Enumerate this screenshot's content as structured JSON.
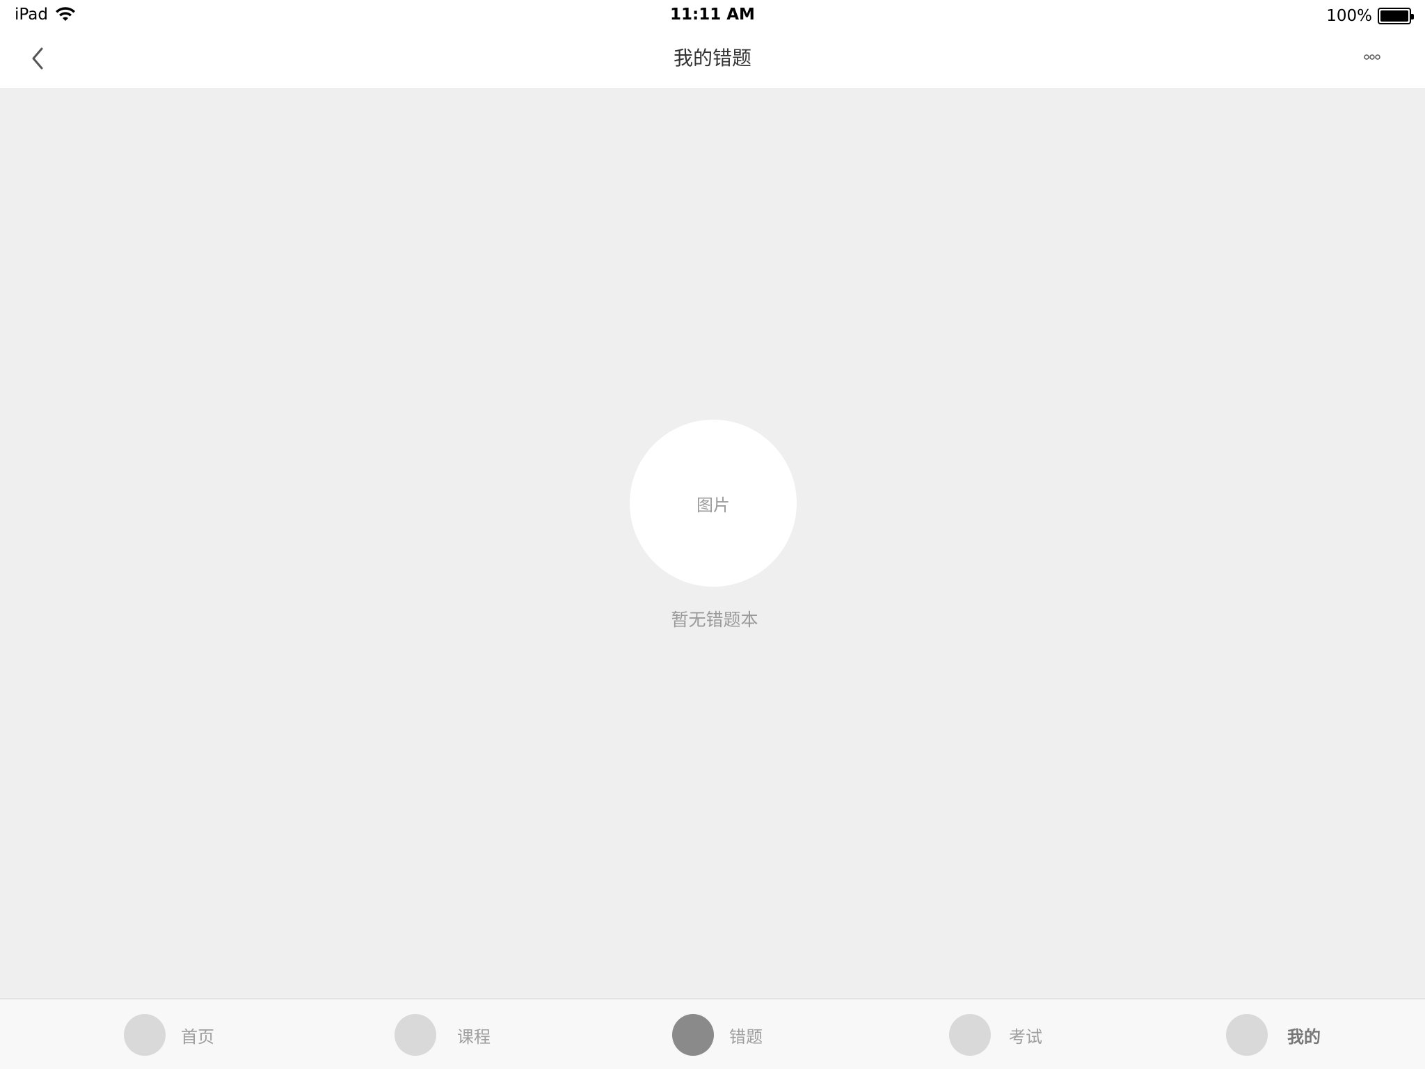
{
  "status_bar": {
    "device": "iPad",
    "time": "11:11 AM",
    "battery": "100%",
    "battery_level": 1.0
  },
  "nav": {
    "title": "我的错题",
    "back_icon": "chevron-left-icon",
    "more_icon": "more-dots-icon"
  },
  "empty_state": {
    "image_placeholder": "图片",
    "message": "暂无错题本"
  },
  "tabs": [
    {
      "label": "首页",
      "active": false
    },
    {
      "label": "课程",
      "active": false
    },
    {
      "label": "错题",
      "active": true
    },
    {
      "label": "考试",
      "active": false
    },
    {
      "label": "我的",
      "active": false
    }
  ],
  "colors": {
    "background": "#efefef",
    "bar_background": "#ffffff",
    "tab_active_icon": "#8a8a8a",
    "tab_inactive_icon": "#d9d9d9"
  }
}
